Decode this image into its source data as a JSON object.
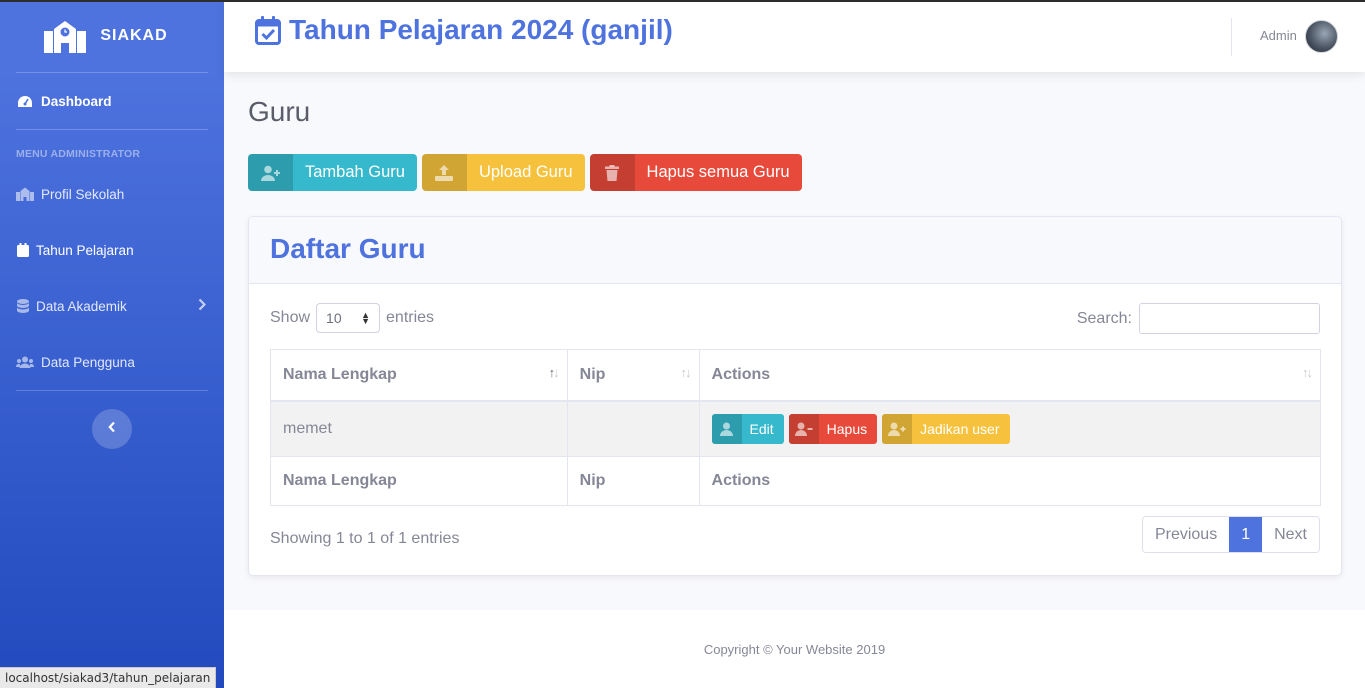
{
  "brand": {
    "name": "SIAKAD",
    "icon": "school-icon"
  },
  "sidebar": {
    "dashboard": "Dashboard",
    "heading": "MENU ADMINISTRATOR",
    "items": [
      {
        "label": "Profil Sekolah",
        "icon": "school-icon"
      },
      {
        "label": "Tahun Pelajaran",
        "icon": "calendar-icon"
      },
      {
        "label": "Data Akademik",
        "icon": "database-icon"
      },
      {
        "label": "Data Pengguna",
        "icon": "users-icon"
      }
    ]
  },
  "status_url": "localhost/siakad3/tahun_pelajaran",
  "topbar": {
    "title": "Tahun Pelajaran 2024 (ganjil)",
    "user": "Admin"
  },
  "page": {
    "heading": "Guru"
  },
  "actions": {
    "add": "Tambah Guru",
    "upload": "Upload Guru",
    "delete_all": "Hapus semua Guru"
  },
  "card": {
    "title": "Daftar Guru"
  },
  "datatable": {
    "show": "Show",
    "entries_value": "10",
    "entries": "entries",
    "search": "Search:",
    "columns": [
      "Nama Lengkap",
      "Nip",
      "Actions"
    ],
    "rows": [
      {
        "nama": "memet",
        "nip": ""
      }
    ],
    "row_actions": {
      "edit": "Edit",
      "delete": "Hapus",
      "make_user": "Jadikan user"
    },
    "info": "Showing 1 to 1 of 1 entries",
    "pagination": {
      "previous": "Previous",
      "current": "1",
      "next": "Next"
    }
  },
  "footer": "Copyright © Your Website 2019",
  "colors": {
    "primary": "#4e73df",
    "info": "#36b9cc",
    "warning": "#f6c23e",
    "danger": "#e74a3b"
  }
}
